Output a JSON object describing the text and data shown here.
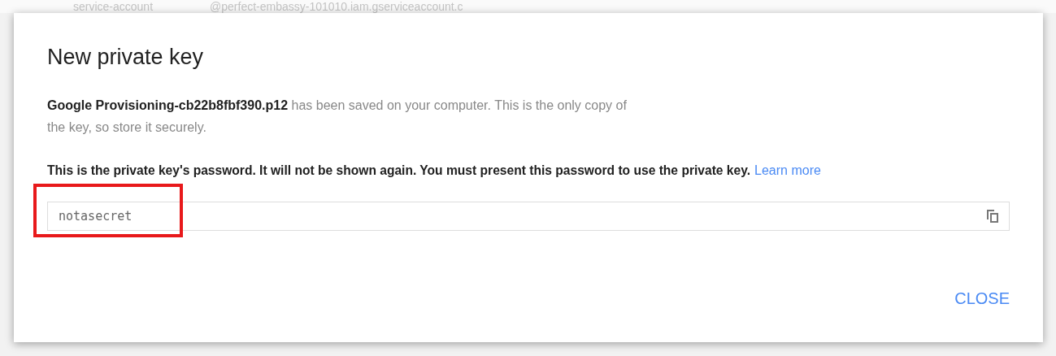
{
  "background_row": {
    "column_1": "service-account",
    "column_2": "@perfect-embassy-101010.iam.gserviceaccount.c"
  },
  "dialog": {
    "title": "New private key",
    "message": "**Google Provisioning-cb22b8fbf390.p12** has been saved on your computer. This is the only copy of the key, so store it securely.",
    "password_note": "This is the private key's password. It will not be shown again. You must present this password to use the private key.",
    "learn_more": "Learn more",
    "password_field": {
      "value": "notasecret",
      "highlighted": true
    },
    "buttons": [
      "CLOSE"
    ]
  }
}
